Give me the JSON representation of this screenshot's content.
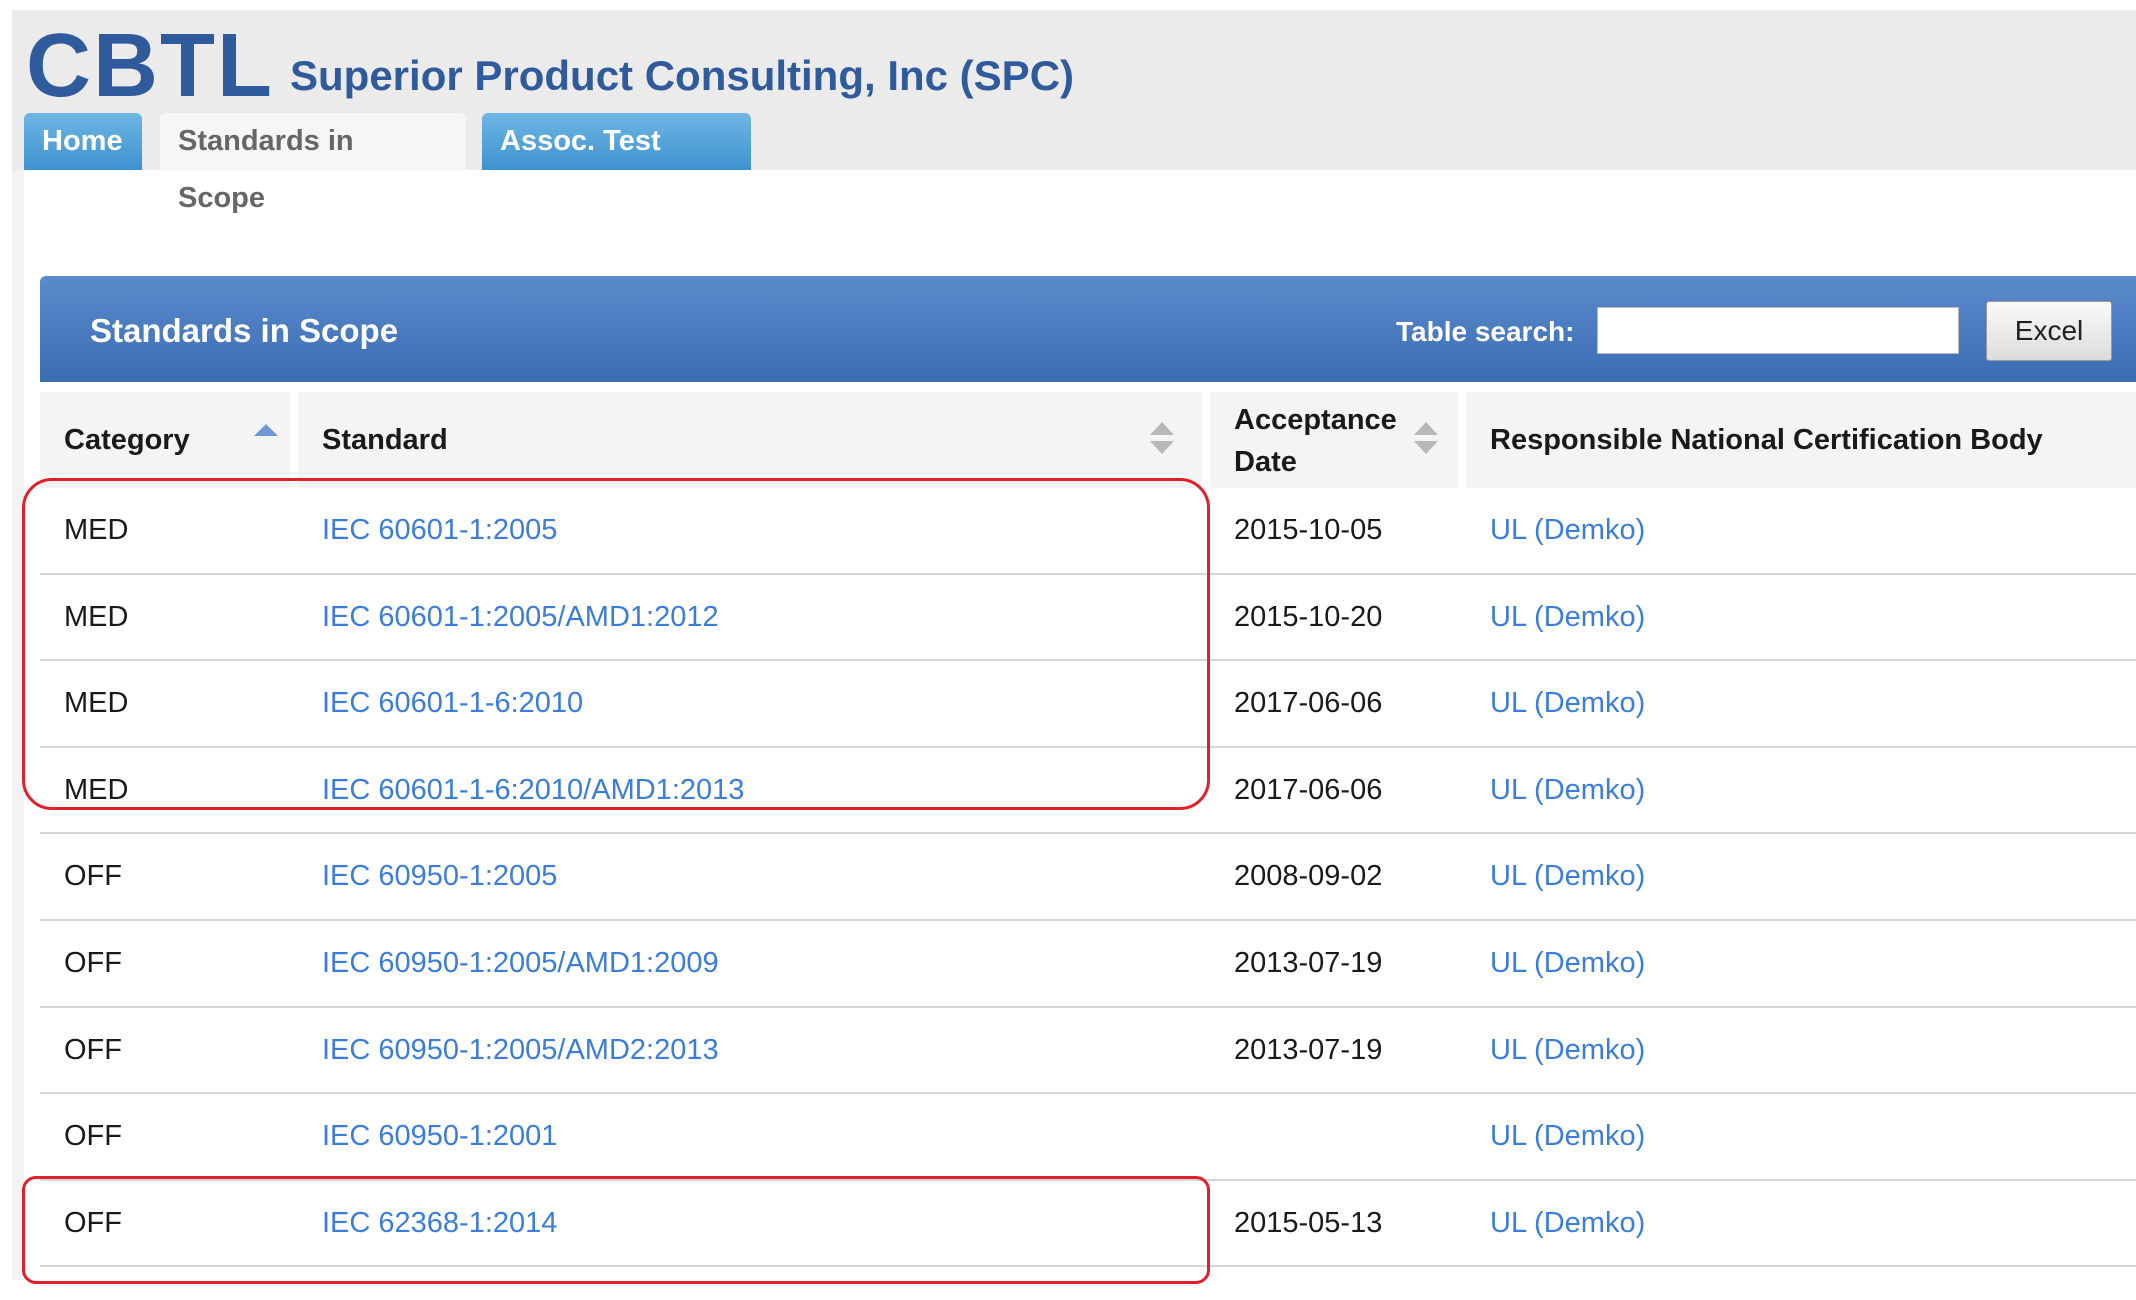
{
  "header": {
    "logo": "CBTL",
    "org_name": "Superior Product Consulting, Inc (SPC)"
  },
  "tabs": [
    {
      "label": "Home",
      "active": false
    },
    {
      "label": "Standards in Scope",
      "active": true
    },
    {
      "label": "Assoc. Test Labs",
      "active": false
    }
  ],
  "panel": {
    "title": "Standards in Scope",
    "search_label": "Table search:",
    "search_value": "",
    "excel_label": "Excel"
  },
  "table": {
    "columns": [
      {
        "label": "Category",
        "sort": "ascending"
      },
      {
        "label": "Standard",
        "sort": "none"
      },
      {
        "label_line1": "Acceptance",
        "label_line2": "Date",
        "sort": "none"
      },
      {
        "label": "Responsible National Certification Body",
        "sort": "none"
      }
    ],
    "rows": [
      {
        "category": "MED",
        "standard": "IEC 60601-1:2005",
        "date": "2015-10-05",
        "body": "UL (Demko)"
      },
      {
        "category": "MED",
        "standard": "IEC 60601-1:2005/AMD1:2012",
        "date": "2015-10-20",
        "body": "UL (Demko)"
      },
      {
        "category": "MED",
        "standard": "IEC 60601-1-6:2010",
        "date": "2017-06-06",
        "body": "UL (Demko)"
      },
      {
        "category": "MED",
        "standard": "IEC 60601-1-6:2010/AMD1:2013",
        "date": "2017-06-06",
        "body": "UL (Demko)"
      },
      {
        "category": "OFF",
        "standard": "IEC 60950-1:2005",
        "date": "2008-09-02",
        "body": "UL (Demko)"
      },
      {
        "category": "OFF",
        "standard": "IEC 60950-1:2005/AMD1:2009",
        "date": "2013-07-19",
        "body": "UL (Demko)"
      },
      {
        "category": "OFF",
        "standard": "IEC 60950-1:2005/AMD2:2013",
        "date": "2013-07-19",
        "body": "UL (Demko)"
      },
      {
        "category": "OFF",
        "standard": "IEC 60950-1:2001",
        "date": "",
        "body": "UL (Demko)"
      },
      {
        "category": "OFF",
        "standard": "IEC 62368-1:2014",
        "date": "2015-05-13",
        "body": "UL (Demko)"
      }
    ]
  },
  "colors": {
    "brand": "#2f5a9c",
    "link": "#3b7ddd",
    "highlight": "#e0202a"
  }
}
